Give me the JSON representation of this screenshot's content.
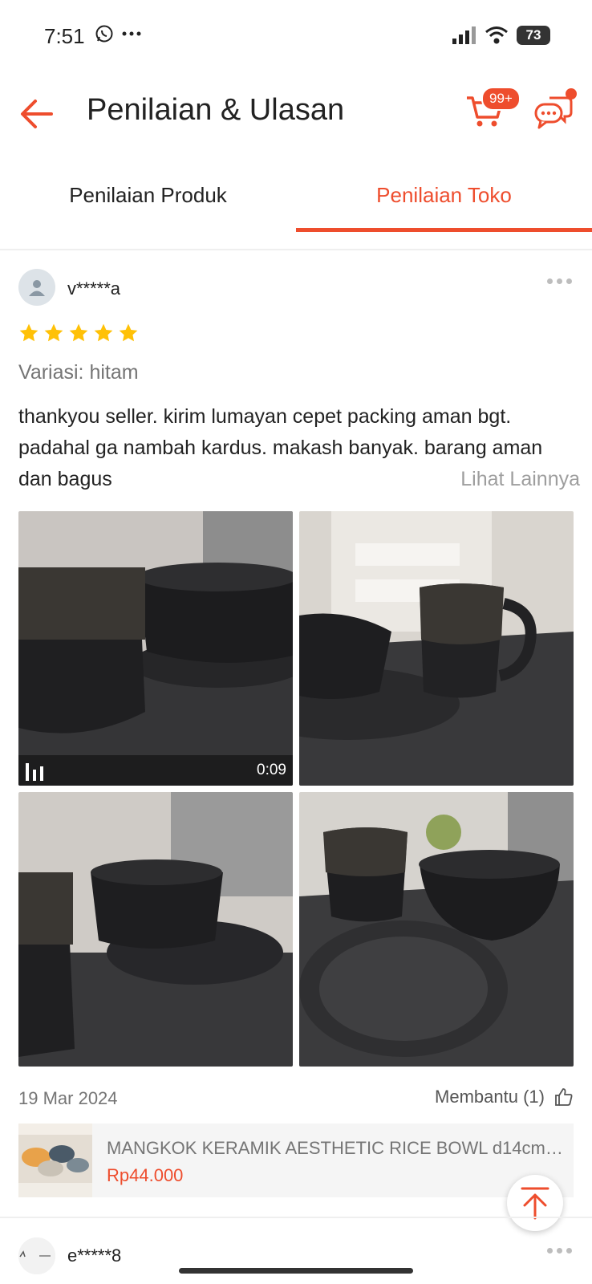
{
  "status_bar": {
    "time": "7:51",
    "battery": "73"
  },
  "header": {
    "title": "Penilaian & Ulasan",
    "cart_badge": "99+"
  },
  "tabs": [
    {
      "label": "Penilaian Produk",
      "active": false
    },
    {
      "label": "Penilaian Toko",
      "active": true
    }
  ],
  "review": {
    "username": "v*****a",
    "rating": 5,
    "variation": "Variasi: hitam",
    "text": "thankyou seller. kirim lumayan cepet packing aman bgt. padahal ga nambah kardus. makash banyak. barang aman dan bagus",
    "see_more": "Lihat Lainnya",
    "video_duration": "0:09",
    "date": "19 Mar 2024",
    "helpful": "Membantu (1)"
  },
  "product": {
    "name": "MANGKOK KERAMIK AESTHETIC RICE BOWL d14cm V...",
    "price": "Rp44.000"
  },
  "next_review": {
    "username": "e*****8"
  },
  "colors": {
    "accent": "#ee4d2d",
    "star": "#ffc107"
  }
}
